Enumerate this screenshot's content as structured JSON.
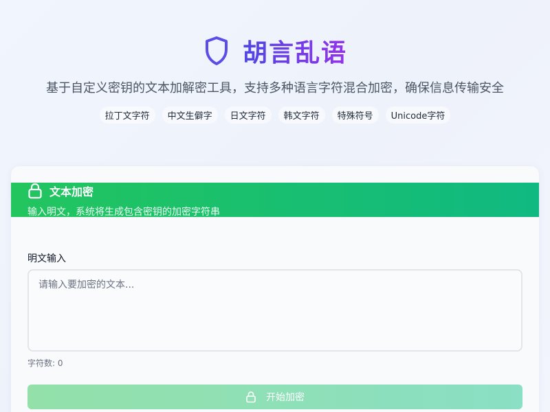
{
  "header": {
    "title": "胡言乱语",
    "subtitle": "基于自定义密钥的文本加解密工具，支持多种语言字符混合加密，确保信息传输安全",
    "logo_icon": "shield-icon",
    "tags": [
      "拉丁文字符",
      "中文生僻字",
      "日文字符",
      "韩文字符",
      "特殊符号",
      "Unicode字符"
    ]
  },
  "encrypt_card": {
    "icon": "lock-icon",
    "title": "文本加密",
    "description": "输入明文，系统将生成包含密钥的加密字符串",
    "input_label": "明文输入",
    "input_value": "",
    "input_placeholder": "请输入要加密的文本...",
    "char_count": "字符数: 0",
    "button_label": "开始加密"
  },
  "colors": {
    "brand_start": "#4f46e5",
    "brand_end": "#9333ea",
    "header_green_start": "#22c55e",
    "header_green_end": "#10b981"
  }
}
